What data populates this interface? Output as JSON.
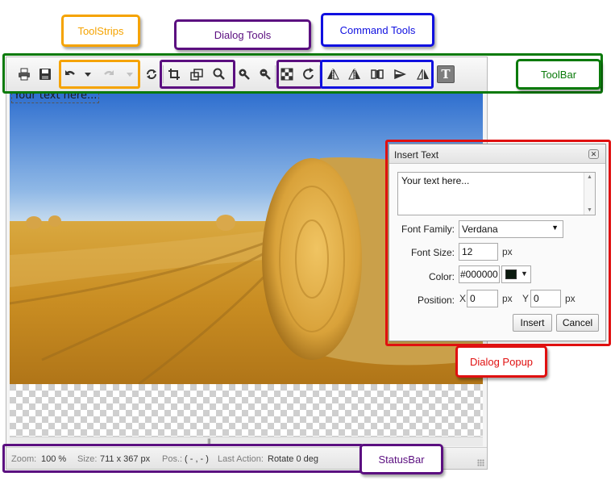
{
  "callouts": {
    "toolstrips": "ToolStrips",
    "dialog_tools": "Dialog Tools",
    "command_tools": "Command Tools",
    "toolbar": "ToolBar",
    "dialog_popup": "Dialog Popup",
    "statusbar": "StatusBar"
  },
  "colors": {
    "toolstrips": "#f5a300",
    "dialog_tools": "#5b0f80",
    "command_tools": "#1010e0",
    "toolbar": "#0a7a0a",
    "dialog_popup": "#e01010",
    "statusbar": "#5b0f80"
  },
  "toolbar_icons": [
    "printer-icon",
    "save-icon",
    "undo-icon",
    "undo-dropdown-icon",
    "redo-icon",
    "redo-dropdown-icon",
    "reset-icon",
    "crop-icon",
    "resize-icon",
    "zoom-icon",
    "zoom-in-icon",
    "zoom-out-icon",
    "transparency-icon",
    "rotate-icon",
    "flip-horizontal-icon",
    "flip-vertical-icon",
    "mirror-icon",
    "skew-right-icon",
    "skew-left-icon",
    "insert-text-icon"
  ],
  "canvas": {
    "overlay_text": "Your text here..."
  },
  "statusbar": {
    "zoom_label": "Zoom:",
    "zoom_value": "100 %",
    "size_label": "Size:",
    "size_value": "711 x 367 px",
    "pos_label": "Pos.:",
    "pos_value": "( - , - )",
    "last_action_label": "Last Action:",
    "last_action_value": "Rotate 0 deg"
  },
  "dialog": {
    "title": "Insert Text",
    "text_value": "Your text here...",
    "font_family_label": "Font Family:",
    "font_family_value": "Verdana",
    "font_size_label": "Font Size:",
    "font_size_value": "12",
    "font_size_unit": "px",
    "color_label": "Color:",
    "color_value": "#000000",
    "position_label": "Position:",
    "x_label": "X",
    "x_value": "0",
    "x_unit": "px",
    "y_label": "Y",
    "y_value": "0",
    "y_unit": "px",
    "insert_label": "Insert",
    "cancel_label": "Cancel"
  }
}
